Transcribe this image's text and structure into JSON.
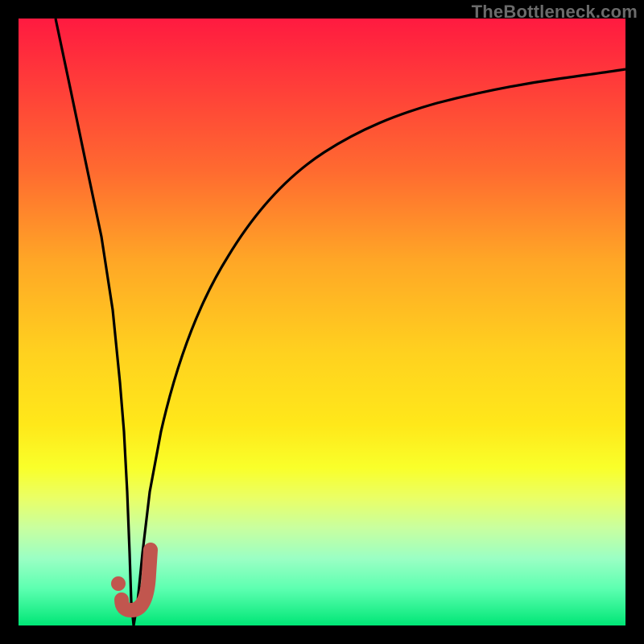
{
  "watermark": "TheBottleneck.com",
  "colors": {
    "curve_stroke": "#000000",
    "marker_stroke": "#c1564e",
    "marker_fill": "#c1564e",
    "gradient_stops": [
      "#ff1a40",
      "#ff3a3a",
      "#ff6a30",
      "#ffa726",
      "#ffd11f",
      "#ffe81a",
      "#f9ff2a",
      "#eaff66",
      "#c8ffa0",
      "#9affc4",
      "#5cffb0",
      "#00e676"
    ]
  },
  "chart_data": {
    "type": "line",
    "title": "",
    "xlabel": "",
    "ylabel": "",
    "xlim": [
      0,
      100
    ],
    "ylim": [
      0,
      100
    ],
    "series": [
      {
        "name": "bottleneck-curve",
        "x": [
          0,
          2,
          4,
          6,
          8,
          10,
          11,
          12,
          13,
          14,
          15,
          16,
          18,
          20,
          22,
          25,
          28,
          32,
          36,
          40,
          45,
          50,
          55,
          60,
          65,
          70,
          75,
          80,
          85,
          90,
          95,
          100
        ],
        "values": [
          100,
          88,
          76,
          64,
          52,
          40,
          32,
          22,
          12,
          4,
          0,
          4,
          12,
          22,
          32,
          44,
          54,
          64,
          71,
          77,
          82,
          85,
          87,
          89,
          90,
          90.8,
          91.4,
          91.8,
          92.1,
          92.3,
          92.4,
          92.5
        ]
      }
    ],
    "markers": [
      {
        "name": "j-marker-dot",
        "shape": "dot",
        "xy": [
          12.5,
          6.0
        ]
      },
      {
        "name": "j-marker-hook",
        "shape": "j-hook",
        "start_xy": [
          14.0,
          10.5
        ],
        "bottom_xy": [
          15.2,
          3.0
        ],
        "end_xy": [
          17.5,
          14.0
        ]
      }
    ],
    "background_gradient": {
      "orientation": "vertical",
      "top": "red",
      "bottom": "green"
    }
  }
}
